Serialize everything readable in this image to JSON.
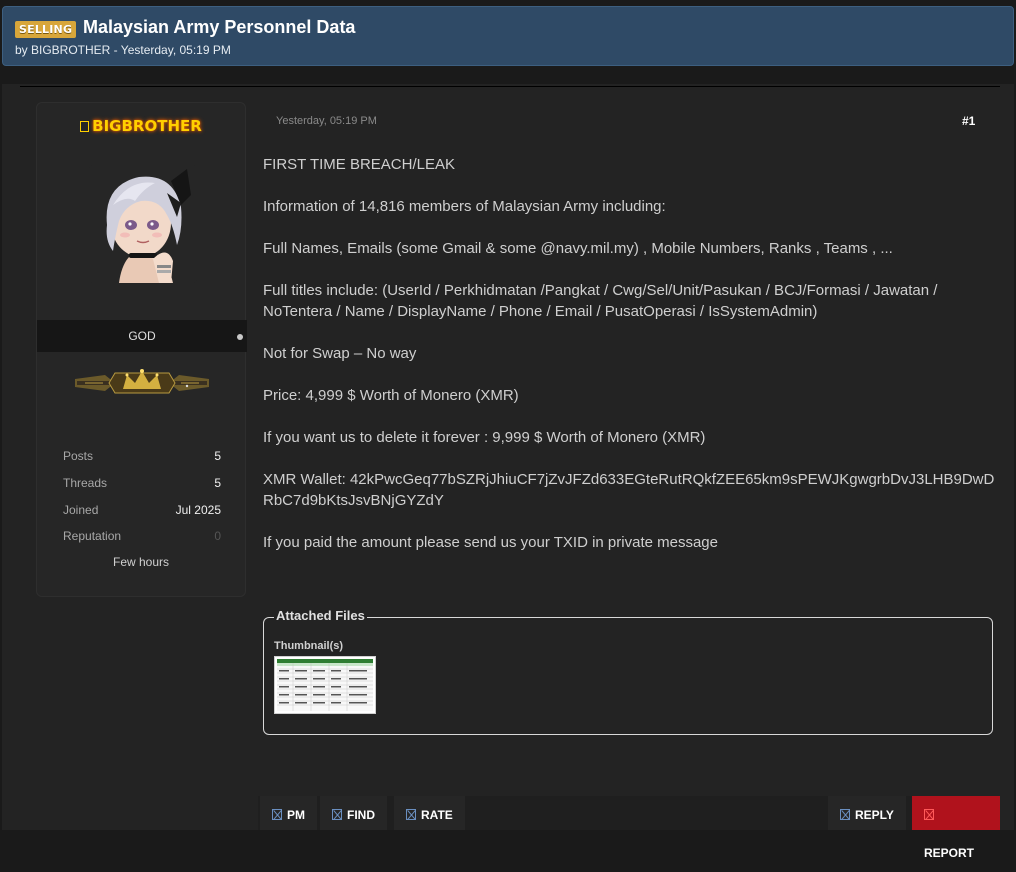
{
  "thread": {
    "prefix": "SELLING",
    "title": "Malaysian Army Personnel Data",
    "meta": "by BIGBROTHER - Yesterday, 05:19 PM"
  },
  "user": {
    "username": "BIGBROTHER",
    "usertitle": "GOD",
    "stats": [
      {
        "label": "Posts",
        "value": "5"
      },
      {
        "label": "Threads",
        "value": "5"
      },
      {
        "label": "Joined",
        "value": "Jul 2025"
      },
      {
        "label": "Reputation",
        "value": "0"
      }
    ],
    "last_seen": "Few hours"
  },
  "post": {
    "date": "Yesterday, 05:19 PM",
    "number": "#1",
    "paragraphs": [
      "FIRST TIME BREACH/LEAK",
      "Information of 14,816 members of Malaysian Army including:",
      "Full Names, Emails (some Gmail & some @navy.mil.my) , Mobile Numbers, Ranks , Teams , ...",
      "Full titles include: (UserId / Perkhidmatan /Pangkat / Cwg/Sel/Unit/Pasukan / BCJ/Formasi / Jawatan / NoTentera / Name / DisplayName / Phone / Email / PusatOperasi / IsSystemAdmin)",
      "Not for Swap – No way",
      "Price: 4,999 $ Worth of Monero (XMR)",
      "If you want us to delete it forever : 9,999 $ Worth of Monero (XMR)",
      "XMR Wallet: 42kPwcGeq77bSZRjJhiuCF7jZvJFZd633EGteRutRQkfZEE65km9sPEWJKgwgrbDvJ3LHB9DwDRbC7d9bKtsJsvBNjGYZdY",
      "If you paid the amount please send us your TXID in private message"
    ]
  },
  "attachments": {
    "legend": "Attached Files",
    "thumb_label": "Thumbnail(s)"
  },
  "actions": {
    "pm": "PM",
    "find": "FIND",
    "rate": "RATE",
    "reply": "REPLY",
    "report": "REPORT"
  },
  "colors": {
    "header_bg": "#2f4a66",
    "prefix_bg": "#d8a63a",
    "username": "#ffd000",
    "report_bg": "#b0121c"
  }
}
